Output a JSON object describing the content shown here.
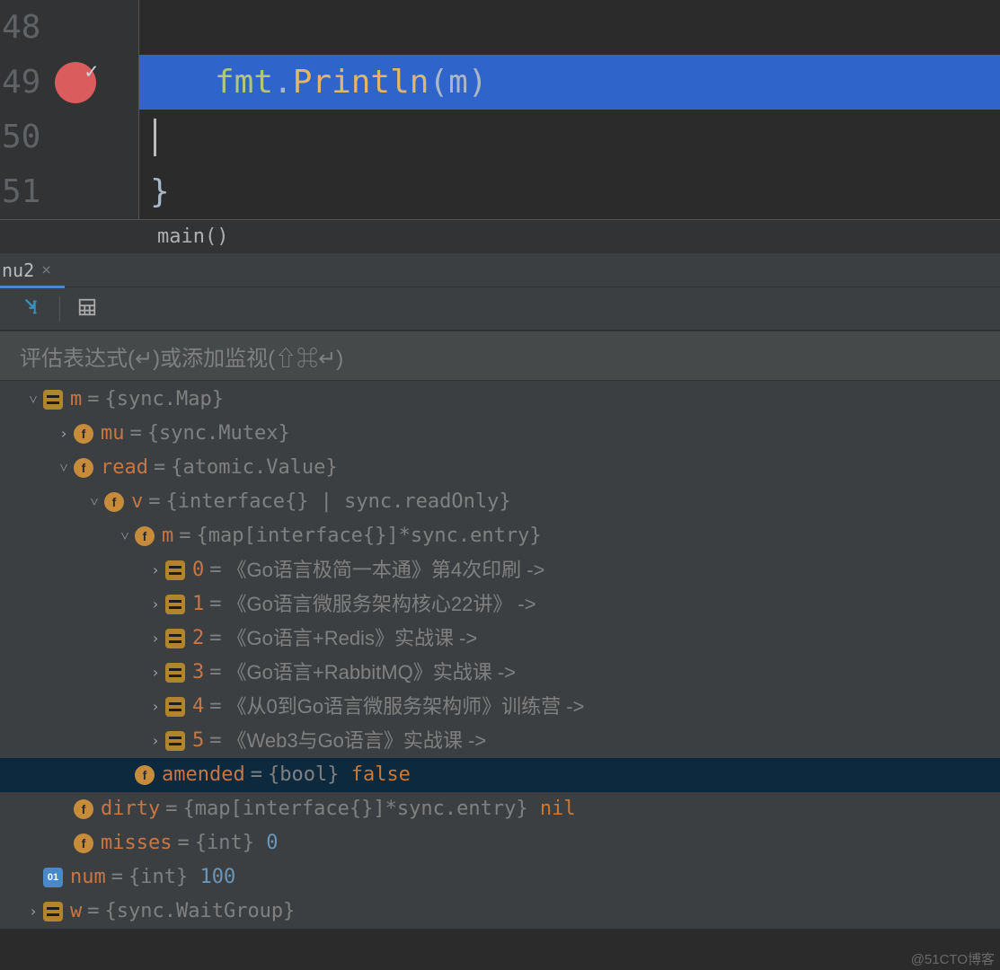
{
  "editor": {
    "lines": {
      "48": "48",
      "49": "49",
      "50": "50",
      "51": "51"
    },
    "code49": {
      "pkg": "fmt",
      "dot": ".",
      "func": "Println",
      "open": "(",
      "arg": "m",
      "close": ")"
    },
    "code51_brace": "}",
    "breadcrumb": "main()"
  },
  "debug": {
    "tab_label": "nu2",
    "eval_placeholder": "评估表达式(↵)或添加监视(⇧⌘↵)"
  },
  "vars": {
    "m": {
      "name": "m",
      "type": "{sync.Map}"
    },
    "mu": {
      "name": "mu",
      "type": "{sync.Mutex}"
    },
    "read": {
      "name": "read",
      "type": "{atomic.Value}"
    },
    "v": {
      "name": "v",
      "type": "{interface{} | sync.readOnly}"
    },
    "m2": {
      "name": "m",
      "type": "{map[interface{}]*sync.entry}"
    },
    "items": {
      "0": {
        "key": "0",
        "val": "《Go语言极简一本通》第4次印刷 ->"
      },
      "1": {
        "key": "1",
        "val": "《Go语言微服务架构核心22讲》 ->"
      },
      "2": {
        "key": "2",
        "val": "《Go语言+Redis》实战课 ->"
      },
      "3": {
        "key": "3",
        "val": "《Go语言+RabbitMQ》实战课 ->"
      },
      "4": {
        "key": "4",
        "val": "《从0到Go语言微服务架构师》训练营 ->"
      },
      "5": {
        "key": "5",
        "val": "《Web3与Go语言》实战课 ->"
      }
    },
    "amended": {
      "name": "amended",
      "type": "{bool}",
      "val": "false"
    },
    "dirty": {
      "name": "dirty",
      "type": "{map[interface{}]*sync.entry}",
      "val": "nil"
    },
    "misses": {
      "name": "misses",
      "type": "{int}",
      "val": "0"
    },
    "num": {
      "name": "num",
      "type": "{int}",
      "val": "100"
    },
    "w": {
      "name": "w",
      "type": "{sync.WaitGroup}"
    }
  },
  "watermark": "@51CTO博客"
}
